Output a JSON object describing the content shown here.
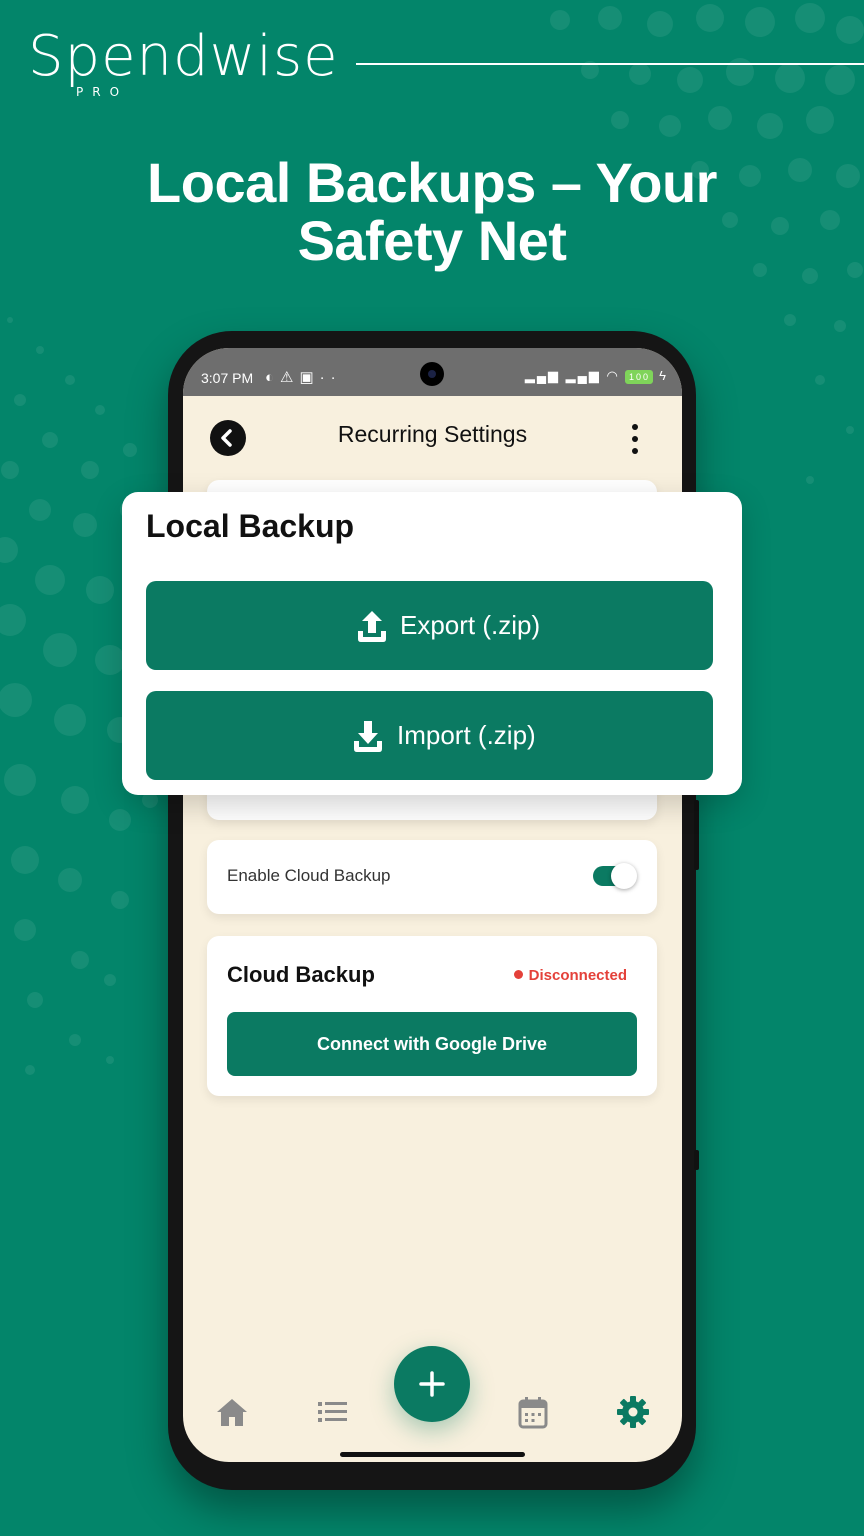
{
  "brand": {
    "name": "Spendwise",
    "sub": "PRO"
  },
  "headline": {
    "line1": "Local Backups – Your",
    "line2": "Safety Net"
  },
  "status_bar": {
    "time": "3:07 PM",
    "battery": "100"
  },
  "app_bar": {
    "title": "Recurring Settings"
  },
  "local_backup": {
    "title": "Local Backup",
    "export_label": "Export (.zip)",
    "import_label": "Import (.zip)"
  },
  "cloud_toggle": {
    "label": "Enable Cloud Backup",
    "enabled": true
  },
  "cloud_backup": {
    "title": "Cloud Backup",
    "status": "Disconnected",
    "connect_label": "Connect with Google Drive"
  },
  "nav": {
    "items": [
      "home-icon",
      "list-icon",
      "add-icon",
      "calendar-icon",
      "settings-icon"
    ],
    "active": "settings-icon"
  },
  "colors": {
    "background": "#03856a",
    "primary": "#0b7a62",
    "screen_bg": "#f8f0de",
    "status_error": "#e4413a"
  }
}
